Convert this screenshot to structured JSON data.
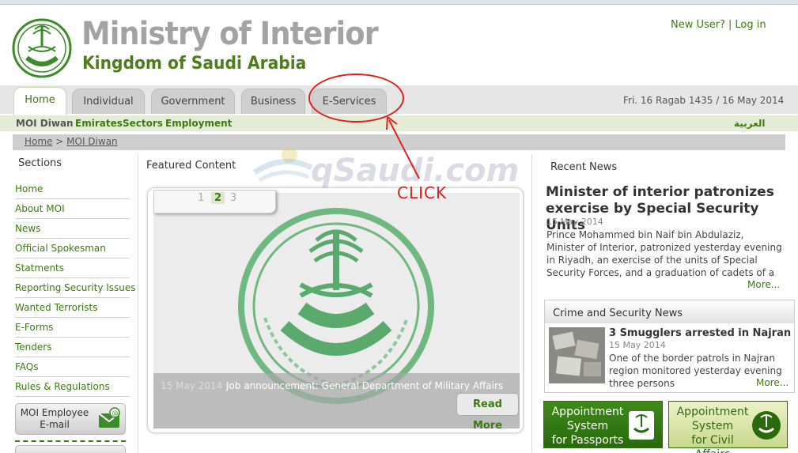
{
  "header": {
    "title_line1": "Ministry of Interior",
    "title_line2": "Kingdom of Saudi Arabia",
    "new_user": "New User?",
    "separator": "|",
    "login": "Log in",
    "date": "Fri. 16 Ragab 1435 / 16 May 2014"
  },
  "tabs": [
    {
      "label": "Home",
      "active": true
    },
    {
      "label": "Individual"
    },
    {
      "label": "Government"
    },
    {
      "label": "Business"
    },
    {
      "label": "E-Services"
    }
  ],
  "subnav": [
    "MOI Diwan",
    "Emirates",
    "Sectors",
    "Employment"
  ],
  "arabic_link": "العربية",
  "breadcrumb": {
    "home": "Home",
    "sep": ">",
    "current": "MOI Diwan"
  },
  "sidebar": {
    "heading": "Sections",
    "items": [
      "Home",
      "About MOI",
      "News",
      "Official Spokesman",
      "Statments",
      "Reporting Security Issues",
      "Wanted Terrorists",
      "E-Forms",
      "Tenders",
      "FAQs",
      "Rules & Regulations"
    ],
    "employee_email": "MOI Employee E-mail"
  },
  "featured": {
    "heading": "Featured Content",
    "pages": [
      "1",
      "2",
      "3"
    ],
    "current_page": "2",
    "caption_date": "15 May 2014 :",
    "caption_text": "Job announcement: General Department of Military Affairs",
    "read_more": "Read More"
  },
  "watermark": "qSaudi.com",
  "annotation": {
    "label": "CLICK",
    "color": "#e02020"
  },
  "recent_news": {
    "heading": "Recent News",
    "title": "Minister of interior patronizes exercise by Special Security Units",
    "date": "15 May 2014",
    "body": "Prince Mohammed bin Naif bin Abdulaziz, Minister of Interior, patronized yesterday evening in Riyadh, an exercise of the units of Special Security Forces, and a graduation of cadets of a number of",
    "more": "More..."
  },
  "crime_news": {
    "heading": "Crime and Security News",
    "title": "3 Smugglers arrested in Najran",
    "date": "15 May 2014",
    "body": "One of the border patrols in Najran region monitored yesterday evening three persons",
    "more": "More..."
  },
  "appointments": [
    {
      "label": "Appointment System for Passports",
      "line1": "Appointment",
      "line2": "System",
      "line3": "for Passports"
    },
    {
      "label": "Appointment System for Civil Affairs",
      "line1": "Appointment",
      "line2": "System",
      "line3": "for Civil Affairs"
    }
  ],
  "colors": {
    "brand_green": "#3d7a12",
    "title_gray": "#a3a3a3",
    "annotation_red": "#e02020"
  }
}
